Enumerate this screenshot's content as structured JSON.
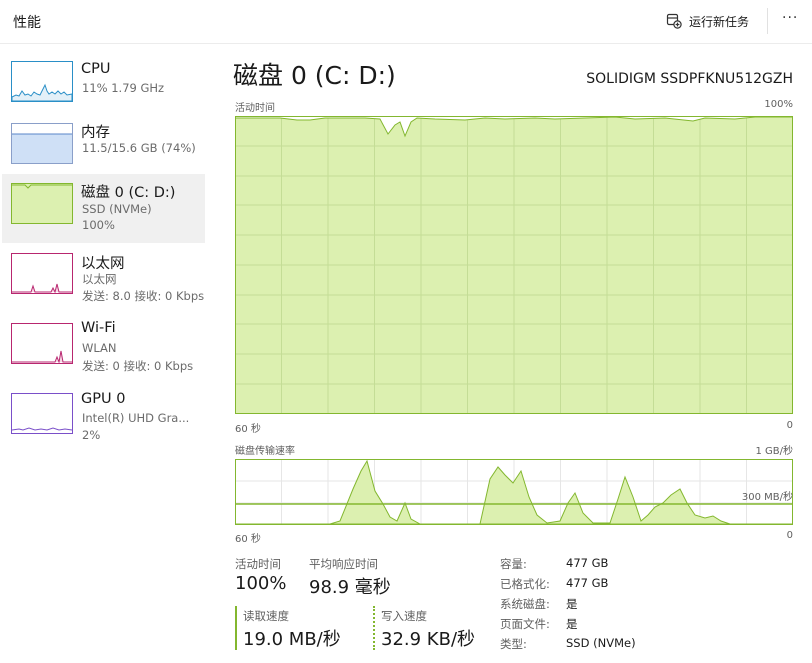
{
  "header": {
    "title": "性能",
    "run_task_label": "运行新任务",
    "more_label": "···"
  },
  "sidebar": {
    "items": [
      {
        "name": "CPU",
        "sub1": "11% 1.79 GHz",
        "sub2": ""
      },
      {
        "name": "内存",
        "sub1": "11.5/15.6 GB (74%)",
        "sub2": ""
      },
      {
        "name": "磁盘 0 (C: D:)",
        "sub1": "SSD (NVMe)",
        "sub2": "100%"
      },
      {
        "name": "以太网",
        "sub1": "以太网",
        "sub2": "发送: 8.0 接收: 0 Kbps"
      },
      {
        "name": "Wi-Fi",
        "sub1": "WLAN",
        "sub2": "发送: 0 接收: 0 Kbps"
      },
      {
        "name": "GPU 0",
        "sub1": "Intel(R) UHD Gra...",
        "sub2": "2%"
      }
    ]
  },
  "main": {
    "title": "磁盘 0 (C: D:)",
    "model": "SOLIDIGM SSDPFKNU512GZH",
    "active_chart": {
      "label": "活动时间",
      "max_label": "100%",
      "left_label": "60 秒",
      "right_label": "0"
    },
    "transfer_chart": {
      "label": "磁盘传输速率",
      "max_label": "1 GB/秒",
      "ref_label": "300 MB/秒",
      "left_label": "60 秒",
      "right_label": "0"
    },
    "stats": {
      "active_label": "活动时间",
      "active_value": "100%",
      "response_label": "平均响应时间",
      "response_value": "98.9 毫秒",
      "read_label": "读取速度",
      "read_value": "19.0 MB/秒",
      "write_label": "写入速度",
      "write_value": "32.9 KB/秒"
    },
    "properties": [
      {
        "key": "容量:",
        "value": "477 GB"
      },
      {
        "key": "已格式化:",
        "value": "477 GB"
      },
      {
        "key": "系统磁盘:",
        "value": "是"
      },
      {
        "key": "页面文件:",
        "value": "是"
      },
      {
        "key": "类型:",
        "value": "SSD (NVMe)"
      }
    ]
  },
  "colors": {
    "disk_green": "#83b72f",
    "disk_fill": "#dcf0b0",
    "cpu_blue": "#2a8fc7",
    "mem_purple": "#8a3fc3",
    "net_pink": "#b8266f",
    "gpu_purple": "#7a4fc9"
  }
}
